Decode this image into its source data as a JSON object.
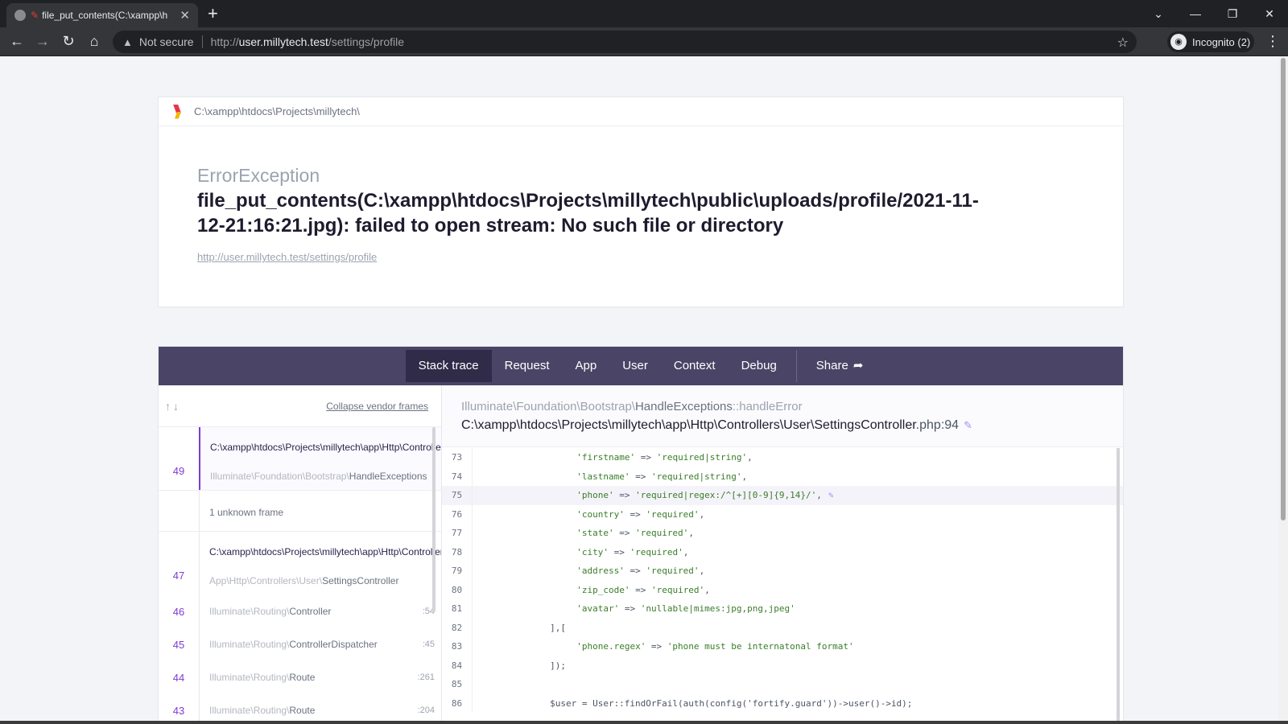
{
  "browser": {
    "tab_title": "file_put_contents(C:\\xampp\\h",
    "url_scheme": "http://",
    "url_host": "user.millytech.test",
    "url_path": "/settings/profile",
    "security_label": "Not secure",
    "profile_label": "Incognito (2)"
  },
  "error": {
    "app_path": "C:\\xampp\\htdocs\\Projects\\millytech\\",
    "exception_class": "ErrorException",
    "message": "file_put_contents(C:\\xampp\\htdocs\\Projects\\millytech\\public\\uploads/profile/2021-11-12-21:16:21.jpg): failed to open stream: No such file or directory",
    "url": "http://user.millytech.test/settings/profile"
  },
  "nav": {
    "items": [
      "Stack trace",
      "Request",
      "App",
      "User",
      "Context",
      "Debug"
    ],
    "share_label": "Share"
  },
  "frames_panel": {
    "collapse_label": "Collapse vendor frames",
    "frame_49": {
      "number": "49",
      "file": "C:\\xampp\\htdocs\\Projects\\millytech\\app\\Http\\Controllers\\User\\SettingsController.php",
      "class_prefix": "Illuminate\\Foundation\\Bootstrap\\",
      "class_leaf": "HandleExceptions"
    },
    "unknown_label": "1 unknown frame",
    "frame_47": {
      "number": "47",
      "file": "C:\\xampp\\htdocs\\Projects\\millytech\\app\\Http\\Controllers\\User\\SettingsController.php",
      "class_prefix": "App\\Http\\Controllers\\User\\",
      "class_leaf": "SettingsController"
    },
    "small_frames": [
      {
        "number": "46",
        "prefix": "Illuminate\\Routing\\",
        "leaf": "Controller",
        "line": ":54"
      },
      {
        "number": "45",
        "prefix": "Illuminate\\Routing\\",
        "leaf": "ControllerDispatcher",
        "line": ":45"
      },
      {
        "number": "44",
        "prefix": "Illuminate\\Routing\\",
        "leaf": "Route",
        "line": ":261"
      },
      {
        "number": "43",
        "prefix": "Illuminate\\Routing\\",
        "leaf": "Route",
        "line": ":204"
      }
    ]
  },
  "snippet": {
    "class_prefix": "Illuminate\\Foundation\\Bootstrap\\",
    "class_leaf": "HandleExceptions",
    "method": "::handleError",
    "file": "C:\\xampp\\htdocs\\Projects\\millytech\\app\\Http\\Controllers\\User\\SettingsController",
    "file_line": ".php:94",
    "lines": [
      {
        "no": "73",
        "key": "'firstname'",
        "op": " => ",
        "val": "'required|string'",
        "tail": ","
      },
      {
        "no": "74",
        "key": "'lastname'",
        "op": " => ",
        "val": "'required|string'",
        "tail": ","
      },
      {
        "no": "75",
        "key": "'phone'",
        "op": " => ",
        "val": "'required|regex:/^[+][0-9]{9,14}/'",
        "tail": ","
      },
      {
        "no": "76",
        "key": "'country'",
        "op": " => ",
        "val": "'required'",
        "tail": ","
      },
      {
        "no": "77",
        "key": "'state'",
        "op": " => ",
        "val": "'required'",
        "tail": ","
      },
      {
        "no": "78",
        "key": "'city'",
        "op": " => ",
        "val": "'required'",
        "tail": ","
      },
      {
        "no": "79",
        "key": "'address'",
        "op": " => ",
        "val": "'required'",
        "tail": ","
      },
      {
        "no": "80",
        "key": "'zip_code'",
        "op": " => ",
        "val": "'required'",
        "tail": ","
      },
      {
        "no": "81",
        "key": "'avatar'",
        "op": " => ",
        "val": "'nullable|mimes:jpg,png,jpeg'",
        "tail": ""
      },
      {
        "no": "82",
        "plain": "],["
      },
      {
        "no": "83",
        "key": "'phone.regex'",
        "op": " => ",
        "val": "'phone must be internatonal format'",
        "tail": ""
      },
      {
        "no": "84",
        "plain": "]);"
      },
      {
        "no": "85",
        "plain": ""
      },
      {
        "no": "86",
        "plain": "$user = User::findOrFail(auth(config('fortify.guard'))->user()->id);"
      }
    ]
  }
}
